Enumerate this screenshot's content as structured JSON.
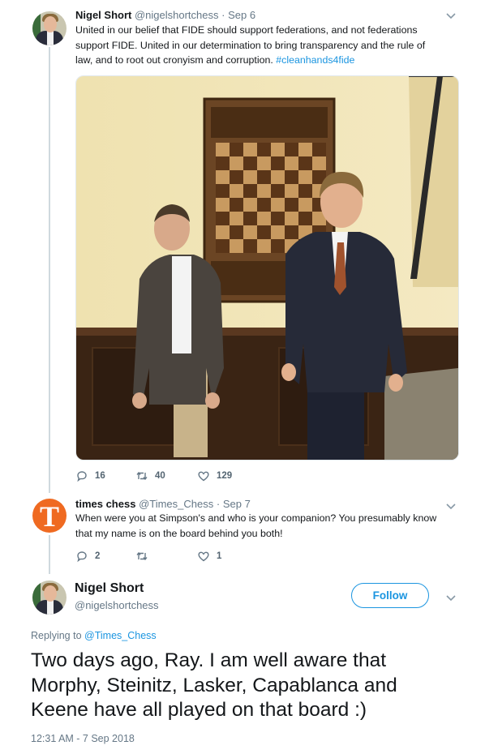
{
  "tweet1": {
    "name": "Nigel Short",
    "handle": "@nigelshortchess",
    "separator": "·",
    "date": "Sep 6",
    "text_lines": [
      "United in our belief that FIDE should support federations, and not federations",
      "support FIDE. United in our determination to bring transparency and the rule of",
      "law, and to root out cronyism and corruption. "
    ],
    "hashtag": "#cleanhands4fide",
    "actions": {
      "replies": "16",
      "retweets": "40",
      "likes": "129"
    },
    "photo_icons": [
      "chessboard-icon"
    ]
  },
  "tweet2": {
    "name": "times chess",
    "handle": "@Times_Chess",
    "separator": "·",
    "date": "Sep 7",
    "avatar_letter": "T",
    "text_lines": [
      "When were you at Simpson's and who is your companion? You presumably know",
      "that my name is on the board behind you both!"
    ],
    "actions": {
      "replies": "2",
      "retweets": "",
      "likes": "1"
    }
  },
  "main_tweet": {
    "name": "Nigel Short",
    "handle": "@nigelshortchess",
    "follow_label": "Follow",
    "replying_prefix": "Replying to ",
    "replying_to": "@Times_Chess",
    "text_lines": [
      "Two days ago, Ray. I am well aware that",
      "Morphy, Steinitz, Lasker, Capablanca and",
      "Keene have all played on that board :)"
    ],
    "timestamp": "12:31 AM - 7 Sep 2018"
  },
  "colors": {
    "accent": "#1b95e0",
    "secondary_text": "#657786",
    "thread_line": "#cfd9de",
    "times_avatar": "#ef6a21"
  }
}
